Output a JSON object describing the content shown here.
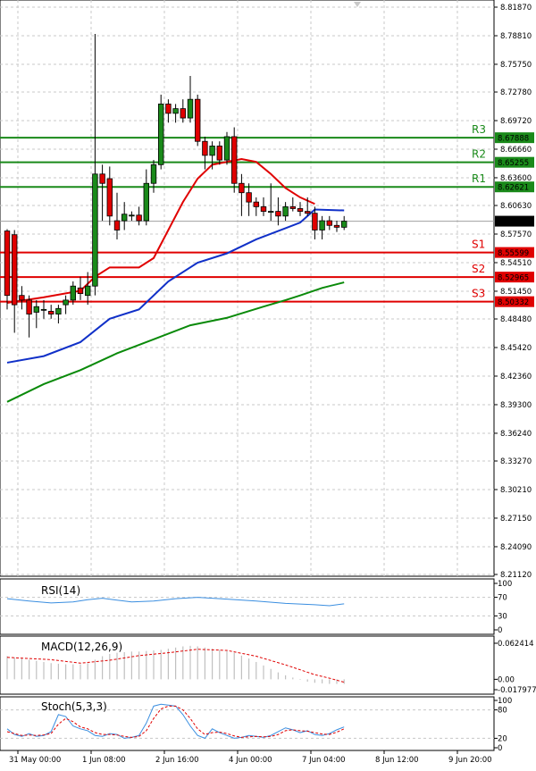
{
  "chart_data": [
    {
      "type": "candlestick",
      "title": "",
      "price_axis": {
        "ticks": [
          "8.81870",
          "8.78810",
          "8.75750",
          "8.72780",
          "8.69720",
          "8.66660",
          "8.63600",
          "8.60630",
          "8.57570",
          "8.54510",
          "8.51450",
          "8.48480",
          "8.45420",
          "8.42360",
          "8.39300",
          "8.36240",
          "8.33270",
          "8.30210",
          "8.27150",
          "8.24090",
          "8.21120"
        ],
        "range": [
          8.2112,
          8.8187
        ]
      },
      "time_axis": {
        "labels": [
          "31 May 00:00",
          "1 Jun 08:00",
          "2 Jun 16:00",
          "4 Jun 00:00",
          "7 Jun 04:00",
          "8 Jun 12:00",
          "9 Jun 20:00"
        ],
        "label_bar_index": [
          0,
          10,
          20,
          30,
          40,
          50,
          60
        ]
      },
      "current_price": "8.58950",
      "candles": [
        [
          8.579,
          8.581,
          8.495,
          8.51
        ],
        [
          8.575,
          8.58,
          8.47,
          8.5
        ],
        [
          8.51,
          8.52,
          8.495,
          8.505
        ],
        [
          8.505,
          8.51,
          8.465,
          8.49
        ],
        [
          8.492,
          8.505,
          8.475,
          8.498
        ],
        [
          8.495,
          8.505,
          8.485,
          8.495
        ],
        [
          8.493,
          8.5,
          8.485,
          8.49
        ],
        [
          8.49,
          8.5,
          8.48,
          8.496
        ],
        [
          8.5,
          8.51,
          8.49,
          8.505
        ],
        [
          8.505,
          8.525,
          8.5,
          8.52
        ],
        [
          8.518,
          8.53,
          8.505,
          8.512
        ],
        [
          8.51,
          8.535,
          8.5,
          8.52
        ],
        [
          8.52,
          8.79,
          8.51,
          8.64
        ],
        [
          8.64,
          8.65,
          8.59,
          8.63
        ],
        [
          8.635,
          8.648,
          8.585,
          8.595
        ],
        [
          8.59,
          8.62,
          8.57,
          8.58
        ],
        [
          8.59,
          8.61,
          8.58,
          8.597
        ],
        [
          8.595,
          8.6,
          8.59,
          8.596
        ],
        [
          8.596,
          8.605,
          8.585,
          8.59
        ],
        [
          8.59,
          8.645,
          8.585,
          8.63
        ],
        [
          8.63,
          8.655,
          8.62,
          8.65
        ],
        [
          8.65,
          8.725,
          8.645,
          8.715
        ],
        [
          8.715,
          8.72,
          8.695,
          8.705
        ],
        [
          8.705,
          8.715,
          8.695,
          8.71
        ],
        [
          8.71,
          8.72,
          8.695,
          8.7
        ],
        [
          8.7,
          8.745,
          8.695,
          8.72
        ],
        [
          8.72,
          8.725,
          8.67,
          8.675
        ],
        [
          8.675,
          8.68,
          8.645,
          8.66
        ],
        [
          8.66,
          8.675,
          8.645,
          8.67
        ],
        [
          8.67,
          8.675,
          8.65,
          8.655
        ],
        [
          8.655,
          8.685,
          8.65,
          8.68
        ],
        [
          8.68,
          8.69,
          8.62,
          8.63
        ],
        [
          8.63,
          8.64,
          8.595,
          8.62
        ],
        [
          8.62,
          8.63,
          8.595,
          8.61
        ],
        [
          8.61,
          8.615,
          8.595,
          8.605
        ],
        [
          8.605,
          8.615,
          8.595,
          8.6
        ],
        [
          8.6,
          8.63,
          8.59,
          8.6
        ],
        [
          8.6,
          8.615,
          8.585,
          8.595
        ],
        [
          8.595,
          8.61,
          8.59,
          8.605
        ],
        [
          8.605,
          8.615,
          8.6,
          8.603
        ],
        [
          8.603,
          8.61,
          8.595,
          8.6
        ],
        [
          8.6,
          8.615,
          8.595,
          8.598
        ],
        [
          8.598,
          8.605,
          8.57,
          8.58
        ],
        [
          8.58,
          8.595,
          8.57,
          8.59
        ],
        [
          8.59,
          8.595,
          8.58,
          8.585
        ],
        [
          8.585,
          8.59,
          8.578,
          8.583
        ],
        [
          8.583,
          8.595,
          8.58,
          8.5895
        ]
      ],
      "moving_averages": [
        {
          "color": "#e00000",
          "points": [
            [
              0,
              8.502
            ],
            [
              5,
              8.508
            ],
            [
              10,
              8.515
            ],
            [
              12,
              8.53
            ],
            [
              14,
              8.54
            ],
            [
              18,
              8.54
            ],
            [
              20,
              8.55
            ],
            [
              22,
              8.58
            ],
            [
              24,
              8.61
            ],
            [
              26,
              8.635
            ],
            [
              28,
              8.65
            ],
            [
              30,
              8.653
            ],
            [
              32,
              8.656
            ],
            [
              34,
              8.653
            ],
            [
              36,
              8.64
            ],
            [
              38,
              8.625
            ],
            [
              40,
              8.615
            ],
            [
              42,
              8.608
            ]
          ]
        },
        {
          "color": "#1030c8",
          "points": [
            [
              0,
              8.438
            ],
            [
              5,
              8.445
            ],
            [
              10,
              8.46
            ],
            [
              14,
              8.485
            ],
            [
              18,
              8.495
            ],
            [
              22,
              8.525
            ],
            [
              26,
              8.545
            ],
            [
              30,
              8.555
            ],
            [
              34,
              8.57
            ],
            [
              38,
              8.582
            ],
            [
              40,
              8.588
            ],
            [
              42,
              8.602
            ],
            [
              46,
              8.601
            ]
          ]
        },
        {
          "color": "#0a8a0a",
          "points": [
            [
              0,
              8.396
            ],
            [
              5,
              8.415
            ],
            [
              10,
              8.43
            ],
            [
              15,
              8.448
            ],
            [
              20,
              8.463
            ],
            [
              25,
              8.478
            ],
            [
              30,
              8.486
            ],
            [
              35,
              8.498
            ],
            [
              38,
              8.505
            ],
            [
              40,
              8.51
            ],
            [
              43,
              8.518
            ],
            [
              46,
              8.524
            ]
          ]
        }
      ],
      "levels": [
        {
          "label": "R3",
          "value": "8.67888",
          "color": "#1a8a1a"
        },
        {
          "label": "R2",
          "value": "8.65255",
          "color": "#1a8a1a"
        },
        {
          "label": "R1",
          "value": "8.62621",
          "color": "#1a8a1a"
        },
        {
          "label": "S1",
          "value": "8.55599",
          "color": "#e00000"
        },
        {
          "label": "S2",
          "value": "8.52965",
          "color": "#e00000"
        },
        {
          "label": "S3",
          "value": "8.50332",
          "color": "#e00000"
        }
      ]
    },
    {
      "type": "line",
      "title": "RSI(14)",
      "ylim": [
        0,
        100
      ],
      "ticks": [
        "100",
        "70",
        "30",
        "0"
      ],
      "levels": [
        70,
        30
      ],
      "color": "#3a8ee0",
      "values": [
        [
          0,
          67
        ],
        [
          3,
          62
        ],
        [
          6,
          58
        ],
        [
          9,
          60
        ],
        [
          11,
          65
        ],
        [
          13,
          68
        ],
        [
          15,
          64
        ],
        [
          17,
          60
        ],
        [
          20,
          62
        ],
        [
          23,
          67
        ],
        [
          26,
          70
        ],
        [
          30,
          66
        ],
        [
          34,
          62
        ],
        [
          38,
          57
        ],
        [
          42,
          54
        ],
        [
          44,
          52
        ],
        [
          46,
          56
        ]
      ]
    },
    {
      "type": "bar",
      "title": "MACD(12,26,9)",
      "ylim": [
        -0.017977,
        0.062414
      ],
      "ticks": [
        "0.062414",
        "0.00",
        "-0.017977"
      ],
      "bar_color": "#c0c0c0",
      "signal_color": "#e00000",
      "values": [
        0.04,
        0.038,
        0.036,
        0.034,
        0.032,
        0.03,
        0.028,
        0.027,
        0.026,
        0.026,
        0.026,
        0.028,
        0.034,
        0.04,
        0.044,
        0.046,
        0.047,
        0.048,
        0.048,
        0.049,
        0.05,
        0.051,
        0.053,
        0.055,
        0.057,
        0.058,
        0.057,
        0.055,
        0.053,
        0.051,
        0.049,
        0.046,
        0.041,
        0.036,
        0.03,
        0.024,
        0.018,
        0.012,
        0.007,
        0.003,
        -0.001,
        -0.004,
        -0.006,
        -0.007,
        -0.008,
        -0.008,
        -0.008
      ],
      "signal": [
        [
          0,
          0.038
        ],
        [
          6,
          0.034
        ],
        [
          10,
          0.028
        ],
        [
          14,
          0.033
        ],
        [
          18,
          0.041
        ],
        [
          22,
          0.046
        ],
        [
          26,
          0.052
        ],
        [
          30,
          0.05
        ],
        [
          34,
          0.04
        ],
        [
          38,
          0.025
        ],
        [
          42,
          0.008
        ],
        [
          44,
          0.002
        ],
        [
          46,
          -0.005
        ]
      ]
    },
    {
      "type": "line",
      "title": "Stoch(5,3,3)",
      "ylim": [
        0,
        100
      ],
      "ticks": [
        "100",
        "80",
        "20",
        "0"
      ],
      "levels": [
        80,
        20
      ],
      "main_color": "#3a8ee0",
      "signal_color": "#e00000",
      "main": [
        [
          0,
          40
        ],
        [
          1,
          28
        ],
        [
          2,
          24
        ],
        [
          3,
          30
        ],
        [
          4,
          24
        ],
        [
          5,
          26
        ],
        [
          6,
          34
        ],
        [
          7,
          70
        ],
        [
          8,
          66
        ],
        [
          9,
          46
        ],
        [
          10,
          40
        ],
        [
          11,
          36
        ],
        [
          12,
          26
        ],
        [
          13,
          24
        ],
        [
          14,
          30
        ],
        [
          15,
          28
        ],
        [
          16,
          20
        ],
        [
          17,
          22
        ],
        [
          18,
          26
        ],
        [
          19,
          52
        ],
        [
          20,
          88
        ],
        [
          21,
          92
        ],
        [
          22,
          90
        ],
        [
          23,
          88
        ],
        [
          24,
          70
        ],
        [
          25,
          46
        ],
        [
          26,
          26
        ],
        [
          27,
          20
        ],
        [
          28,
          40
        ],
        [
          29,
          32
        ],
        [
          30,
          26
        ],
        [
          31,
          20
        ],
        [
          32,
          22
        ],
        [
          33,
          26
        ],
        [
          34,
          24
        ],
        [
          35,
          22
        ],
        [
          36,
          26
        ],
        [
          37,
          34
        ],
        [
          38,
          42
        ],
        [
          39,
          38
        ],
        [
          40,
          32
        ],
        [
          41,
          36
        ],
        [
          42,
          28
        ],
        [
          43,
          26
        ],
        [
          44,
          30
        ],
        [
          45,
          38
        ],
        [
          46,
          44
        ]
      ],
      "signal": [
        [
          0,
          34
        ],
        [
          1,
          30
        ],
        [
          2,
          26
        ],
        [
          3,
          27
        ],
        [
          4,
          26
        ],
        [
          5,
          27
        ],
        [
          6,
          30
        ],
        [
          7,
          50
        ],
        [
          8,
          62
        ],
        [
          9,
          55
        ],
        [
          10,
          44
        ],
        [
          11,
          40
        ],
        [
          12,
          32
        ],
        [
          13,
          28
        ],
        [
          14,
          28
        ],
        [
          15,
          27
        ],
        [
          16,
          24
        ],
        [
          17,
          22
        ],
        [
          18,
          24
        ],
        [
          19,
          36
        ],
        [
          20,
          62
        ],
        [
          21,
          82
        ],
        [
          22,
          88
        ],
        [
          23,
          88
        ],
        [
          24,
          80
        ],
        [
          25,
          62
        ],
        [
          26,
          40
        ],
        [
          27,
          28
        ],
        [
          28,
          32
        ],
        [
          29,
          33
        ],
        [
          30,
          30
        ],
        [
          31,
          25
        ],
        [
          32,
          22
        ],
        [
          33,
          23
        ],
        [
          34,
          24
        ],
        [
          35,
          23
        ],
        [
          36,
          24
        ],
        [
          37,
          28
        ],
        [
          38,
          36
        ],
        [
          39,
          38
        ],
        [
          40,
          36
        ],
        [
          41,
          35
        ],
        [
          42,
          32
        ],
        [
          43,
          29
        ],
        [
          44,
          28
        ],
        [
          45,
          33
        ],
        [
          46,
          40
        ]
      ]
    }
  ]
}
